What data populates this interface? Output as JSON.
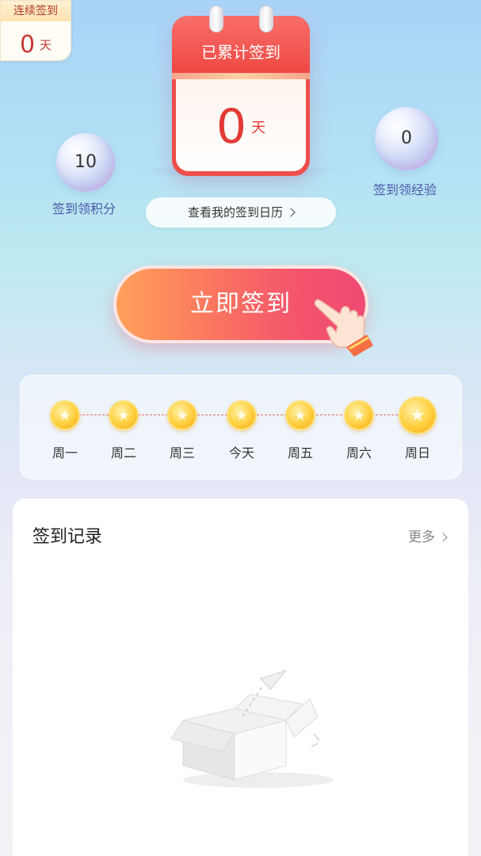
{
  "streak": {
    "title": "连续签到",
    "count": "0",
    "unit": "天"
  },
  "calendar": {
    "title": "已累计签到",
    "count": "0",
    "unit": "天"
  },
  "points": {
    "value": "10",
    "label": "签到领积分"
  },
  "experience": {
    "value": "0",
    "label": "签到领经验"
  },
  "calendar_link": {
    "label": "查看我的签到日历"
  },
  "sign_button": {
    "label": "立即签到"
  },
  "week": {
    "days": [
      {
        "label": "周一"
      },
      {
        "label": "周二"
      },
      {
        "label": "周三"
      },
      {
        "label": "今天"
      },
      {
        "label": "周五"
      },
      {
        "label": "周六"
      },
      {
        "label": "周日"
      }
    ]
  },
  "records": {
    "title": "签到记录",
    "more": "更多"
  },
  "icons": {
    "coin": "star-coin-icon",
    "hand": "pointing-hand-icon",
    "chevron": "chevron-right-icon",
    "empty": "empty-box-icon"
  },
  "colors": {
    "accent": "#ef4e4a",
    "button_start": "#ffa15a",
    "button_end": "#ef4a73",
    "coin": "#ffcf3e"
  }
}
